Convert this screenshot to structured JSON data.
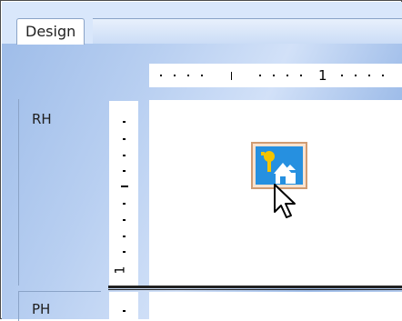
{
  "tabs": [
    {
      "label": "Design",
      "active": true
    }
  ],
  "ruler": {
    "horizontal_label": "1",
    "vertical_label": "1"
  },
  "sections": {
    "report_header": {
      "label": "RH"
    },
    "page_header": {
      "label": "PH"
    }
  },
  "component": {
    "icon": "image-icon"
  },
  "cursor": {
    "icon": "arrow-cursor-icon"
  },
  "colors": {
    "tab_strip": "#d9e7fb",
    "designer_bg": "#b8cff1",
    "component_border": "#d09c73",
    "component_fill": "#2a93e0"
  }
}
